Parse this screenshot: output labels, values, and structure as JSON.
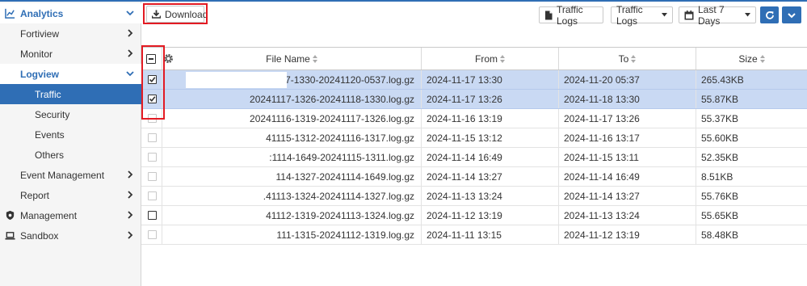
{
  "sidebar": {
    "items": [
      {
        "label": "Analytics",
        "icon": "chart-icon",
        "expanded": true
      },
      {
        "label": "Fortiview"
      },
      {
        "label": "Monitor"
      },
      {
        "label": "Logview",
        "expanded": true
      },
      {
        "label": "Traffic",
        "active": true
      },
      {
        "label": "Security"
      },
      {
        "label": "Events"
      },
      {
        "label": "Others"
      },
      {
        "label": "Event Management"
      },
      {
        "label": "Report"
      },
      {
        "label": "Management",
        "icon": "shield-icon"
      },
      {
        "label": "Sandbox",
        "icon": "laptop-icon"
      }
    ]
  },
  "toolbar": {
    "download_label": "Download",
    "traffic_logs_button": "Traffic Logs",
    "log_type_select": "Traffic Logs",
    "time_range_select": "Last 7 Days"
  },
  "table": {
    "columns": [
      "File Name",
      "From",
      "To",
      "Size"
    ],
    "rows": [
      {
        "file": "41117-1330-20241120-0537.log.gz",
        "from": "2024-11-17 13:30",
        "to": "2024-11-20 05:37",
        "size": "265.43KB",
        "selected": true
      },
      {
        "file": "20241117-1326-20241118-1330.log.gz",
        "from": "2024-11-17 13:26",
        "to": "2024-11-18 13:30",
        "size": "55.87KB",
        "selected": true
      },
      {
        "file": "20241116-1319-20241117-1326.log.gz",
        "from": "2024-11-16 13:19",
        "to": "2024-11-17 13:26",
        "size": "55.37KB",
        "selected": false
      },
      {
        "file": "41115-1312-20241116-1317.log.gz",
        "from": "2024-11-15 13:12",
        "to": "2024-11-16 13:17",
        "size": "55.60KB",
        "selected": false
      },
      {
        "file": ":1114-1649-20241115-1311.log.gz",
        "from": "2024-11-14 16:49",
        "to": "2024-11-15 13:11",
        "size": "52.35KB",
        "selected": false
      },
      {
        "file": "114-1327-20241114-1649.log.gz",
        "from": "2024-11-14 13:27",
        "to": "2024-11-14 16:49",
        "size": "8.51KB",
        "selected": false
      },
      {
        "file": ".41113-1324-20241114-1327.log.gz",
        "from": "2024-11-13 13:24",
        "to": "2024-11-14 13:27",
        "size": "55.76KB",
        "selected": false
      },
      {
        "file": "41112-1319-20241113-1324.log.gz",
        "from": "2024-11-12 13:19",
        "to": "2024-11-13 13:24",
        "size": "55.65KB",
        "selected": false
      },
      {
        "file": "111-1315-20241112-1319.log.gz",
        "from": "2024-11-11 13:15",
        "to": "2024-11-12 13:19",
        "size": "58.48KB",
        "selected": false
      }
    ]
  },
  "colors": {
    "accent": "#2f6eb5",
    "highlight": "#e31b23",
    "selected_row": "#c9d9f3"
  }
}
